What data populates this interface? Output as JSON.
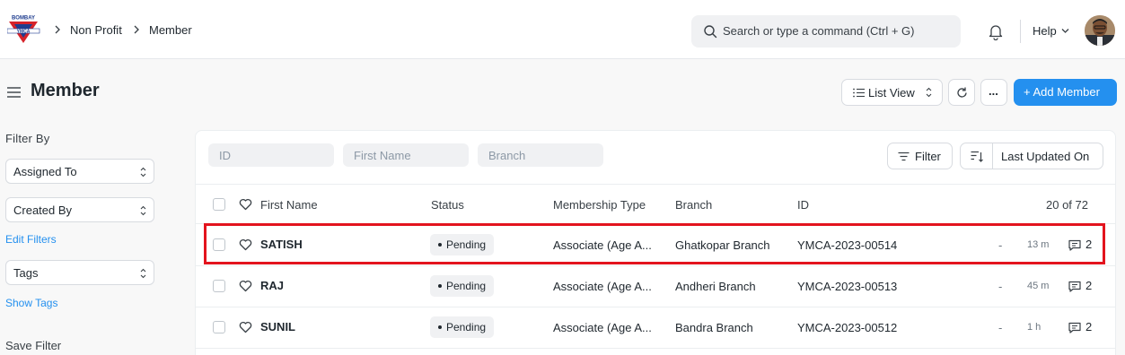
{
  "navbar": {
    "breadcrumbs": [
      "Non Profit",
      "Member"
    ],
    "search_placeholder": "Search or type a command (Ctrl + G)",
    "help_label": "Help"
  },
  "page": {
    "title": "Member",
    "list_view_label": "List View",
    "more_label": "...",
    "add_button_label": "+ Add Member"
  },
  "sidebar": {
    "filter_by_label": "Filter By",
    "assigned_to_label": "Assigned To",
    "created_by_label": "Created By",
    "edit_filters_label": "Edit Filters",
    "tags_label": "Tags",
    "show_tags_label": "Show Tags",
    "save_filter_label": "Save Filter"
  },
  "filters": {
    "id_placeholder": "ID",
    "first_name_placeholder": "First Name",
    "branch_placeholder": "Branch",
    "filter_button_label": "Filter",
    "sort_label": "Last Updated On"
  },
  "table": {
    "headers": {
      "first_name": "First Name",
      "status": "Status",
      "membership_type": "Membership Type",
      "branch": "Branch",
      "id": "ID",
      "count": "20 of 72"
    },
    "rows": [
      {
        "first_name": "SATISH",
        "status": "Pending",
        "membership_type": "Associate (Age A...",
        "branch": "Ghatkopar Branch",
        "id": "YMCA-2023-00514",
        "dash": "-",
        "modified": "13 m",
        "comments": "2"
      },
      {
        "first_name": "RAJ",
        "status": "Pending",
        "membership_type": "Associate (Age A...",
        "branch": "Andheri Branch",
        "id": "YMCA-2023-00513",
        "dash": "-",
        "modified": "45 m",
        "comments": "2"
      },
      {
        "first_name": "SUNIL",
        "status": "Pending",
        "membership_type": "Associate (Age A...",
        "branch": "Bandra Branch",
        "id": "YMCA-2023-00512",
        "dash": "-",
        "modified": "1 h",
        "comments": "2"
      }
    ]
  },
  "logo": {
    "text": "BOMBAY YMCA"
  },
  "colors": {
    "primary": "#2490ef",
    "highlight": "#e3141e",
    "logo_red": "#d6232a",
    "logo_blue": "#1f3d8f"
  },
  "icons": [
    "menu-icon",
    "search-icon",
    "bell-icon",
    "chevron-down-icon",
    "refresh-icon",
    "filter-icon",
    "sort-icon",
    "heart-icon",
    "comment-icon",
    "list-icon"
  ]
}
